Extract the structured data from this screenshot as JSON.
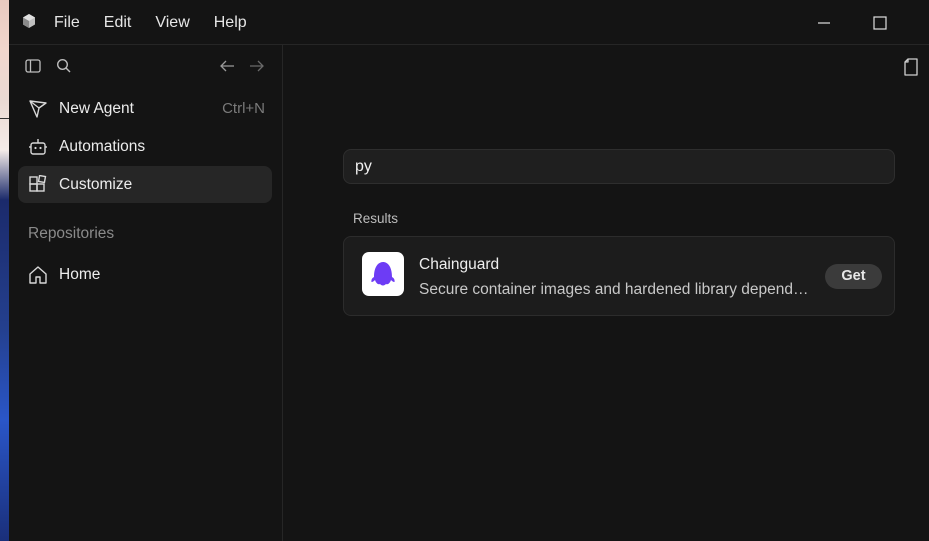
{
  "menu": {
    "items": [
      "File",
      "Edit",
      "View",
      "Help"
    ]
  },
  "sidebar": {
    "nav": [
      {
        "label": "New Agent",
        "shortcut": "Ctrl+N",
        "icon": "new-agent-icon"
      },
      {
        "label": "Automations",
        "icon": "robot-icon"
      },
      {
        "label": "Customize",
        "icon": "blocks-icon",
        "active": true
      }
    ],
    "section_title": "Repositories",
    "repos": [
      {
        "label": "Home",
        "icon": "home-icon"
      }
    ]
  },
  "main": {
    "search": {
      "value": "py"
    },
    "results_label": "Results",
    "results": [
      {
        "title": "Chainguard",
        "description": "Secure container images and hardened library depend…",
        "action": "Get",
        "accent": "#6d3cf5"
      }
    ]
  }
}
